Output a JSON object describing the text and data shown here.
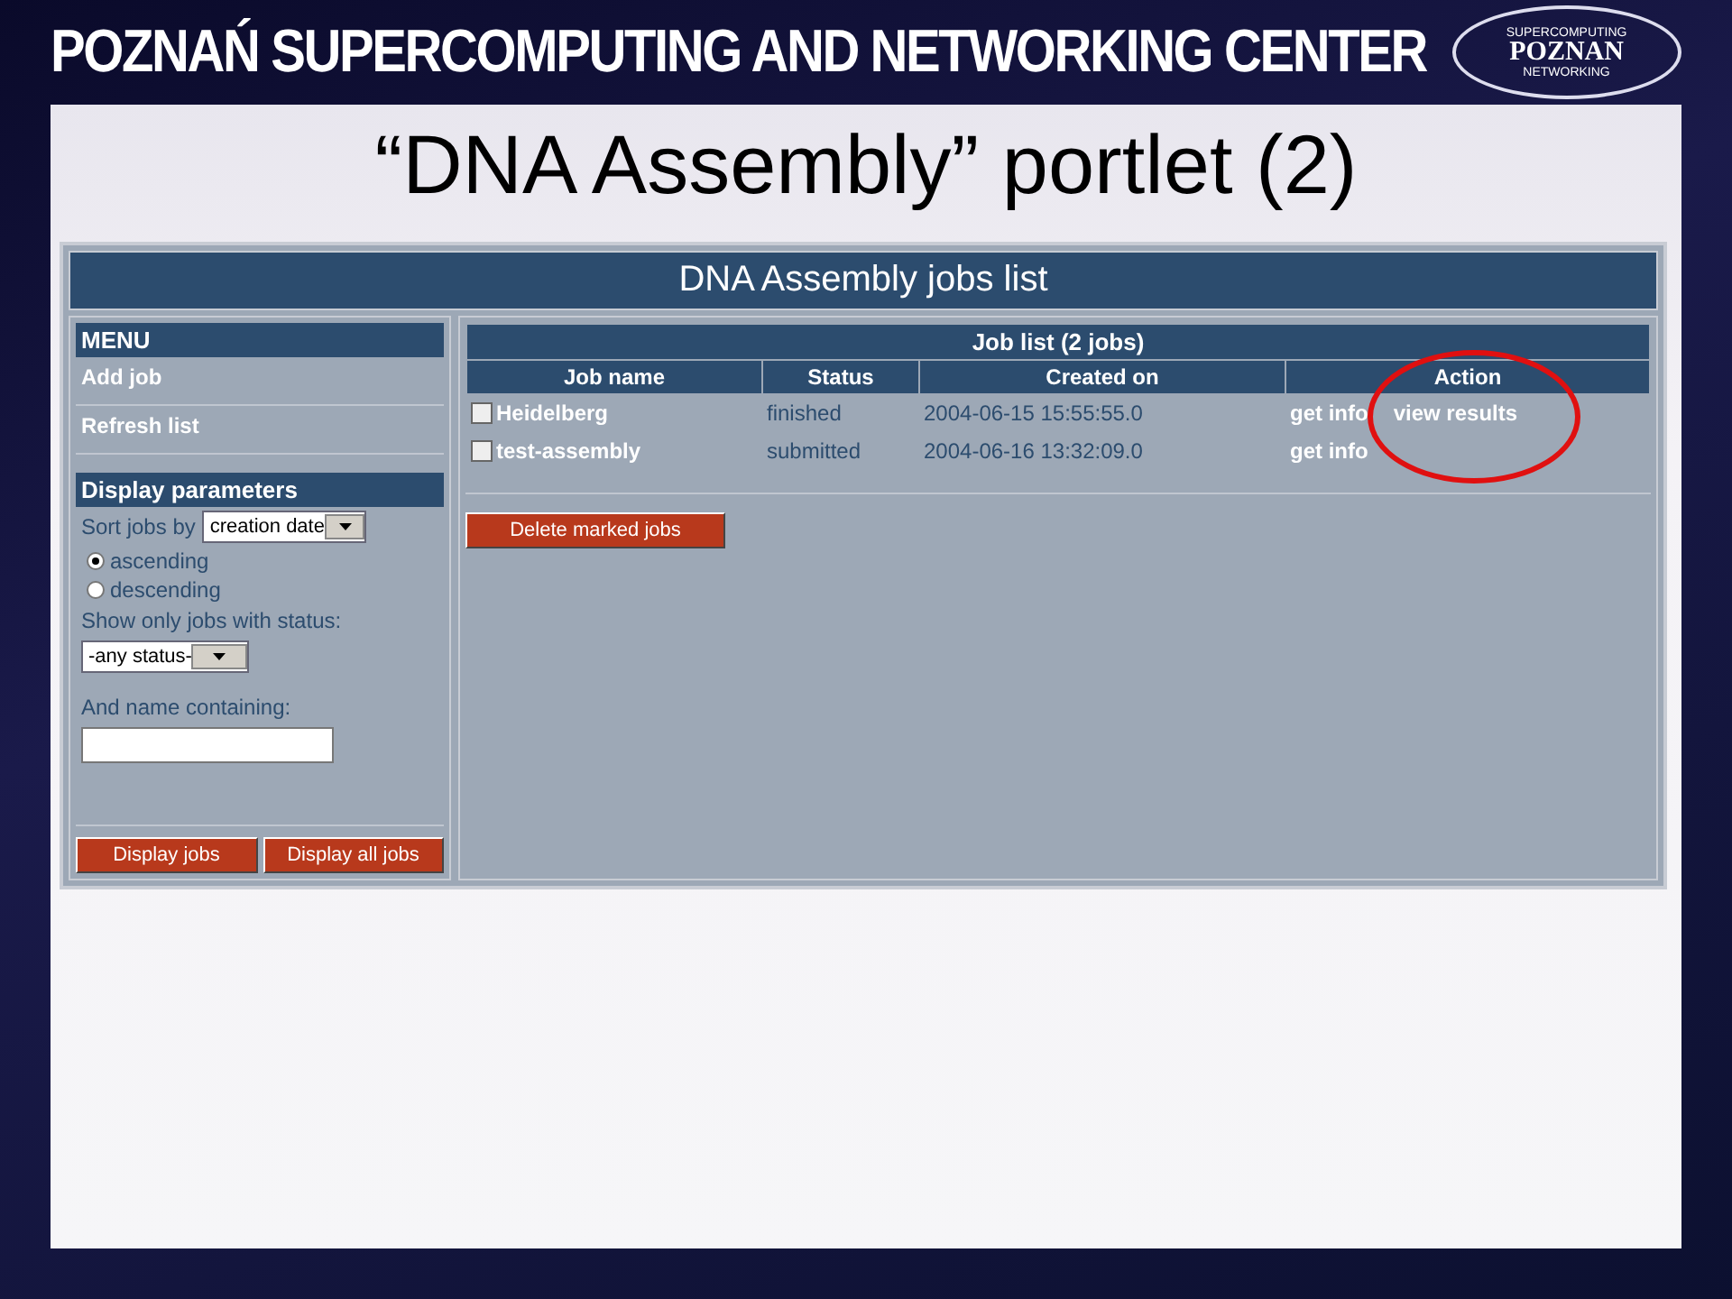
{
  "header": {
    "organization": "POZNAŃ SUPERCOMPUTING AND NETWORKING CENTER",
    "logo": {
      "top": "SUPERCOMPUTING",
      "main": "POZNAN",
      "bottom": "NETWORKING"
    }
  },
  "slide": {
    "title": "“DNA Assembly” portlet (2)"
  },
  "portlet": {
    "title": "DNA Assembly jobs list",
    "menu": {
      "heading": "MENU",
      "items": [
        "Add job",
        "Refresh list"
      ]
    },
    "display_parameters": {
      "heading": "Display parameters",
      "sort_label": "Sort jobs by",
      "sort_value": "creation date",
      "order_options": [
        {
          "label": "ascending",
          "selected": true
        },
        {
          "label": "descending",
          "selected": false
        }
      ],
      "status_label": "Show only jobs with status:",
      "status_value": "-any status-",
      "name_label": "And name containing:",
      "buttons": [
        "Display jobs",
        "Display all jobs"
      ]
    },
    "job_list": {
      "title": "Job list (2 jobs)",
      "columns": [
        "Job name",
        "Status",
        "Created on",
        "Action"
      ],
      "rows": [
        {
          "checked": false,
          "name": "Heidelberg",
          "status": "finished",
          "created_on": "2004-06-15 15:55:55.0",
          "actions": [
            "get info",
            "view results"
          ]
        },
        {
          "checked": false,
          "name": "test-assembly",
          "status": "submitted",
          "created_on": "2004-06-16 13:32:09.0",
          "actions": [
            "get info"
          ]
        }
      ],
      "delete_button": "Delete marked jobs"
    }
  }
}
